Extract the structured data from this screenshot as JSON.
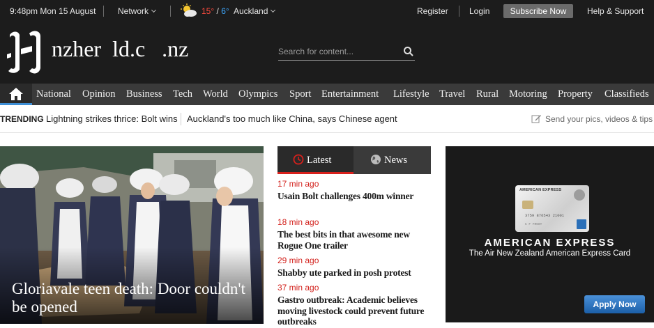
{
  "topbar": {
    "datetime": "9:48pm Mon 15 August",
    "network_label": "Network",
    "weather_icon": "partly-cloudy-icon",
    "temp_high": "15°",
    "temp_sep": "/",
    "temp_low": "6°",
    "location": "Auckland",
    "register": "Register",
    "login": "Login",
    "subscribe": "Subscribe Now",
    "help": "Help & Support"
  },
  "masthead": {
    "logo_text": "nzher  ld.c   .nz",
    "search_placeholder": "Search for content..."
  },
  "nav": {
    "home_icon": "home-icon",
    "items": [
      "National",
      "Opinion",
      "Business",
      "Tech",
      "World",
      "Olympics",
      "Sport",
      "Entertainment",
      "Lifestyle",
      "Travel",
      "Rural",
      "Motoring",
      "Property",
      "Classifieds"
    ]
  },
  "trending": {
    "label": "TRENDING",
    "links": [
      "Lightning strikes thrice: Bolt wins",
      "Auckland's too much like China, says Chinese agent"
    ],
    "send_label": "Send your pics, videos & tips"
  },
  "hero": {
    "headline": "Gloriavale teen death: Door couldn't be opened"
  },
  "latest": {
    "tabs": [
      "Latest",
      "News"
    ],
    "stories": [
      {
        "time": "17 min ago",
        "title": "Usain Bolt challenges 400m winner"
      },
      {
        "time": "18 min ago",
        "title": "The best bits in that awesome new Rogue One trailer"
      },
      {
        "time": "29 min ago",
        "title": "Shabby ute parked in posh protest"
      },
      {
        "time": "37 min ago",
        "title": "Gastro outbreak: Academic believes moving livestock could prevent future outbreaks"
      }
    ]
  },
  "ad": {
    "card_brand": "AMERICAN EXPRESS",
    "card_number": "3759 876543 21001",
    "card_name": "C F FROST",
    "brand": "AMERICAN EXPRESS",
    "tagline": "The Air New Zealand American Express Card",
    "cta": "Apply Now"
  },
  "colors": {
    "bar_bg": "#1c1c1c",
    "nav_bg": "#3a3a3a",
    "accent_red": "#d3231e",
    "accent_blue": "#3e8fd6",
    "cta_blue": "#2f7bc9"
  }
}
